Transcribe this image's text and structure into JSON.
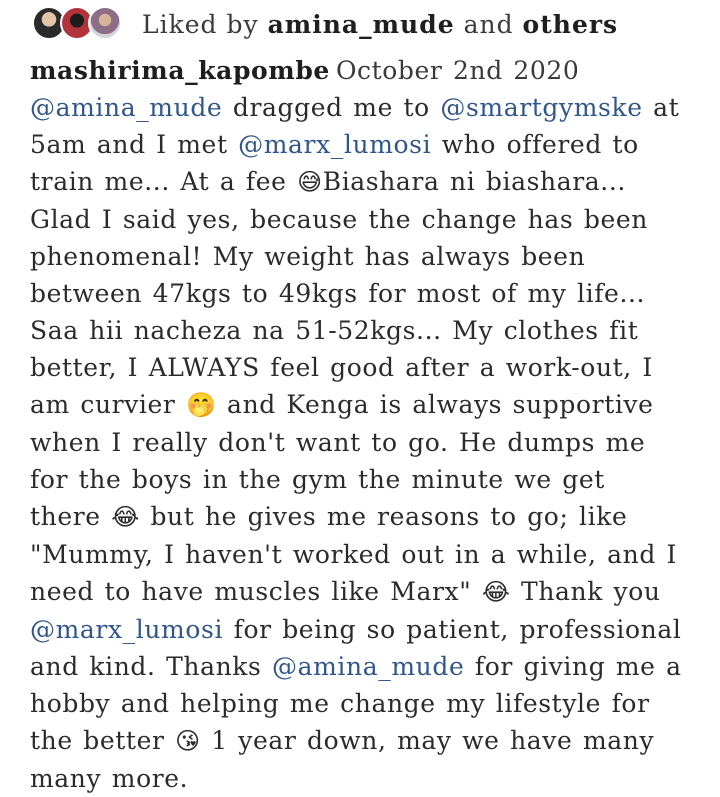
{
  "likes": {
    "prefix": "Liked by",
    "user": "amina_mude",
    "joiner": "and",
    "others": "others"
  },
  "post": {
    "username": "mashirima_kapombe",
    "date": "October 2nd 2020",
    "segments": [
      {
        "t": "@amina_mude",
        "k": "mention"
      },
      {
        "t": " dragged me to ",
        "k": "text"
      },
      {
        "t": "@smartgymske",
        "k": "mention"
      },
      {
        "t": " at 5am and I met ",
        "k": "text"
      },
      {
        "t": "@marx_lumosi",
        "k": "mention"
      },
      {
        "t": " who offered to train me... At a fee ",
        "k": "text"
      },
      {
        "t": "😅",
        "k": "emoji"
      },
      {
        "t": "Biashara ni biashara... Glad I said yes, because the change has been phenomenal! My weight has always been between 47kgs to 49kgs for most of my life... Saa hii nacheza na 51-52kgs... My clothes fit better, I ALWAYS feel good after a work-out, I am curvier ",
        "k": "text"
      },
      {
        "t": "🤭",
        "k": "emoji"
      },
      {
        "t": " and Kenga is always supportive when I really don't want to go. He dumps me for the boys in the gym the minute we get there ",
        "k": "text"
      },
      {
        "t": "😂",
        "k": "emoji"
      },
      {
        "t": " but he gives me reasons to go; like \"Mummy, I haven't worked out in a while, and I need to have muscles like Marx\" ",
        "k": "text"
      },
      {
        "t": "😂",
        "k": "emoji"
      },
      {
        "t": " Thank you ",
        "k": "text"
      },
      {
        "t": "@marx_lumosi",
        "k": "mention"
      },
      {
        "t": " for being so patient, professional and kind. Thanks ",
        "k": "text"
      },
      {
        "t": "@amina_mude",
        "k": "mention"
      },
      {
        "t": " for giving me a hobby and helping me change my lifestyle for the better ",
        "k": "text"
      },
      {
        "t": "😘",
        "k": "emoji"
      },
      {
        "t": " 1 year down, may we have many many more.",
        "k": "text"
      }
    ]
  }
}
